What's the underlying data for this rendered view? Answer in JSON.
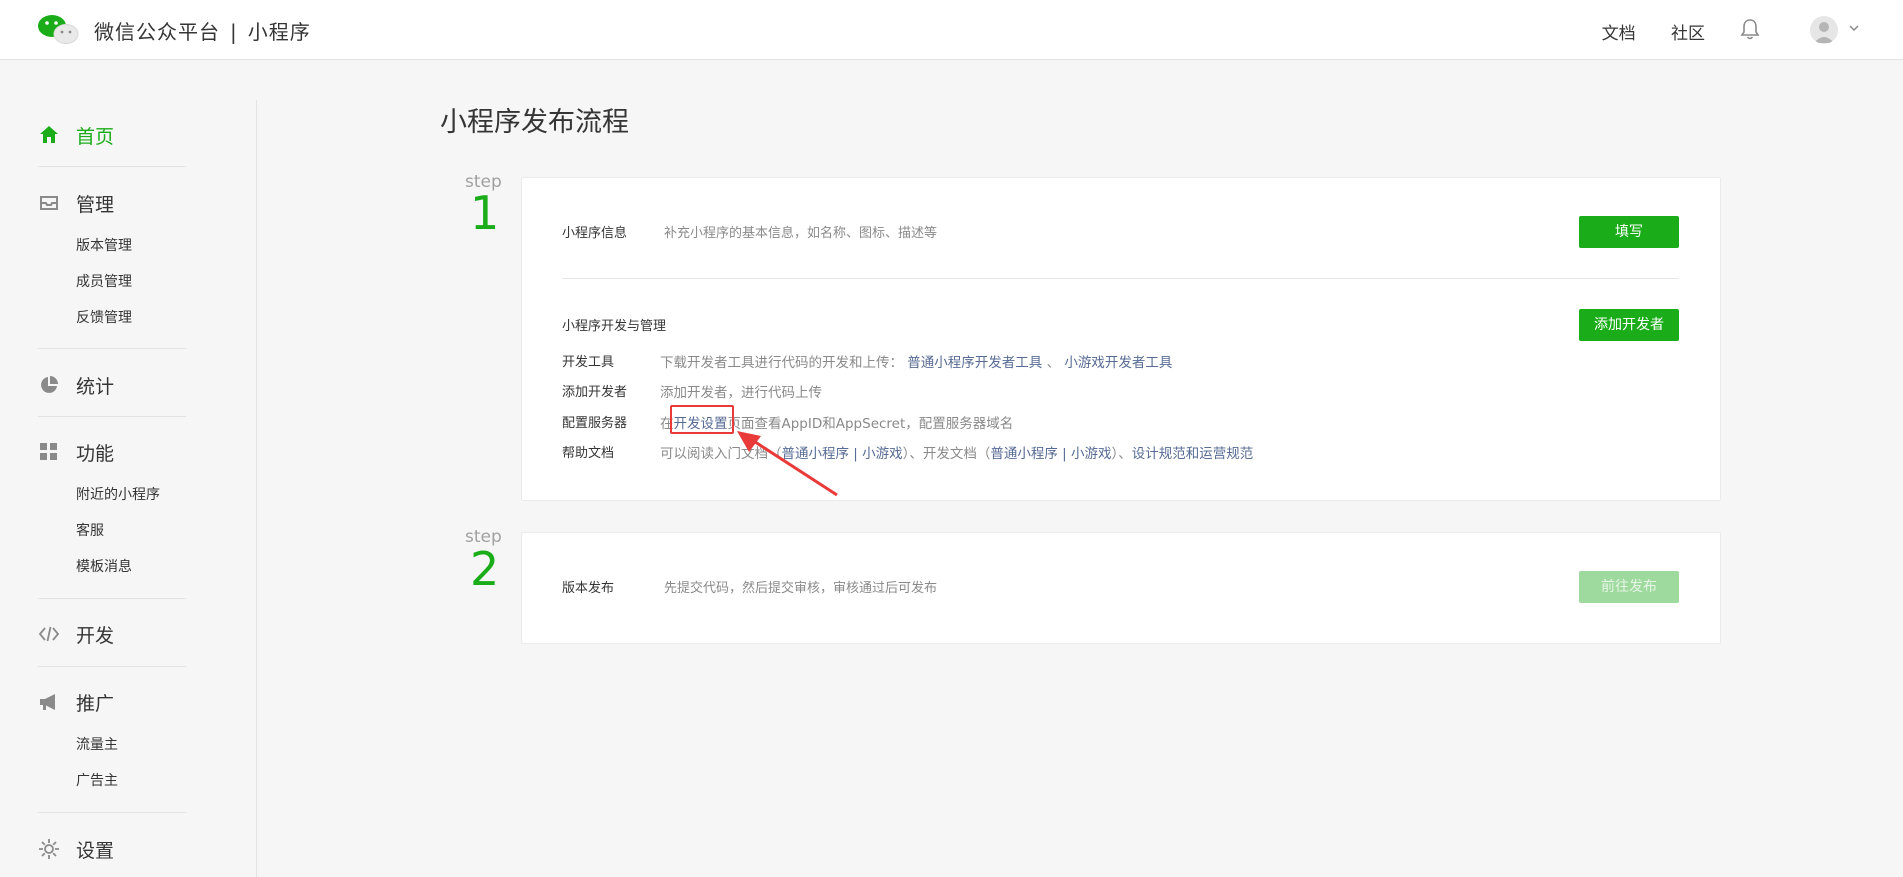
{
  "header": {
    "brand": "微信公众平台",
    "separator": "|",
    "product": "小程序",
    "links": [
      "文档",
      "社区"
    ]
  },
  "sidebar": {
    "sections": [
      {
        "label": "首页",
        "icon": "home-icon",
        "active": true,
        "items": []
      },
      {
        "label": "管理",
        "icon": "inbox-icon",
        "items": [
          "版本管理",
          "成员管理",
          "反馈管理"
        ]
      },
      {
        "label": "统计",
        "icon": "pie-chart-icon",
        "items": []
      },
      {
        "label": "功能",
        "icon": "grid-icon",
        "items": [
          "附近的小程序",
          "客服",
          "模板消息"
        ]
      },
      {
        "label": "开发",
        "icon": "code-icon",
        "items": []
      },
      {
        "label": "推广",
        "icon": "megaphone-icon",
        "items": [
          "流量主",
          "广告主"
        ]
      },
      {
        "label": "设置",
        "icon": "gear-icon",
        "items": []
      }
    ]
  },
  "main": {
    "title": "小程序发布流程",
    "step1": {
      "label": "step",
      "num": "1",
      "info": {
        "title": "小程序信息",
        "desc": "补充小程序的基本信息，如名称、图标、描述等",
        "button": "填写"
      },
      "dev": {
        "title": "小程序开发与管理",
        "button": "添加开发者",
        "rows": {
          "tools": {
            "label": "开发工具",
            "prefix": "下载开发者工具进行代码的开发和上传：",
            "link1": "普通小程序开发者工具",
            "sep": "、",
            "link2": "小游戏开发者工具"
          },
          "add": {
            "label": "添加开发者",
            "text": "添加开发者，进行代码上传"
          },
          "server": {
            "label": "配置服务器",
            "prefix": "在",
            "link": "开发设置",
            "suffix": "页面查看AppID和AppSecret，配置服务器域名"
          },
          "help": {
            "label": "帮助文档",
            "prefix": "可以阅读入门文档（",
            "l1": "普通小程序",
            "bar1": " | ",
            "l2": "小游戏",
            "mid": "）、开发文档（",
            "l3": "普通小程序",
            "bar2": " | ",
            "l4": "小游戏",
            "mid2": "）、",
            "l5": "设计规范",
            "and": "和",
            "l6": "运营规范"
          }
        }
      }
    },
    "step2": {
      "label": "step",
      "num": "2",
      "title": "版本发布",
      "desc": "先提交代码，然后提交审核，审核通过后可发布",
      "button": "前往发布"
    }
  },
  "colors": {
    "accent": "#1aad19",
    "link": "#576b95",
    "annotation": "#e93a3a"
  }
}
